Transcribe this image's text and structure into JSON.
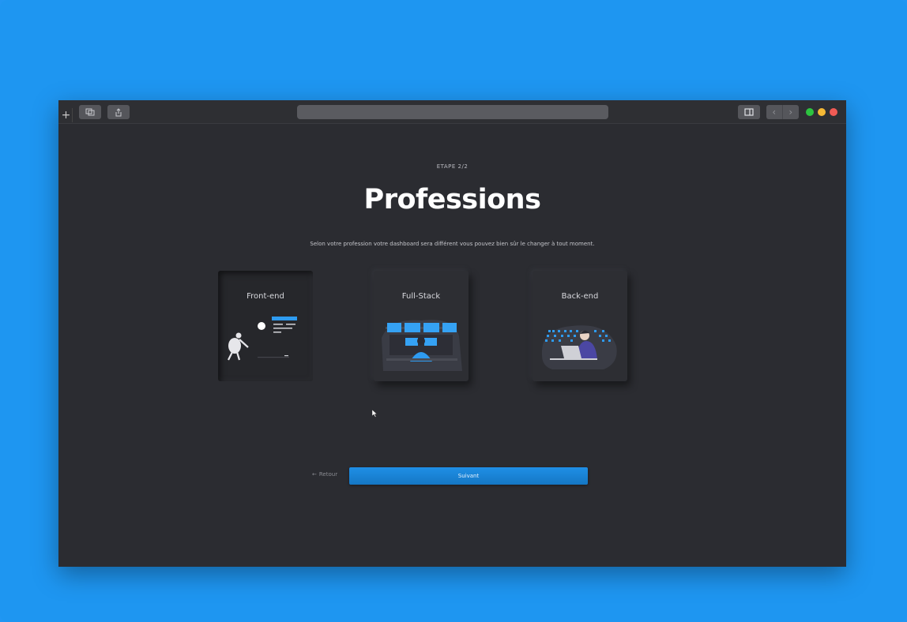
{
  "page": {
    "step_label": "ETAPE 2/2",
    "title": "Professions",
    "subtitle": "Selon votre profession votre dashboard sera différent vous pouvez bien sûr le changer à tout moment.",
    "cards": [
      {
        "label": "Front-end",
        "icon": "front-end-illustration",
        "selected": true
      },
      {
        "label": "Full-Stack",
        "icon": "full-stack-illustration",
        "selected": false
      },
      {
        "label": "Back-end",
        "icon": "back-end-illustration",
        "selected": false
      }
    ],
    "back_label": "Retour",
    "next_label": "Suivant"
  },
  "browser": {
    "new_tab_icon": "plus-icon",
    "traffic_lights": {
      "green": "#2DC440",
      "yellow": "#F5B935",
      "red": "#F05B55"
    }
  },
  "colors": {
    "background": "#2196F3",
    "surface": "#2B2C31",
    "accent": "#1F8FE6"
  }
}
